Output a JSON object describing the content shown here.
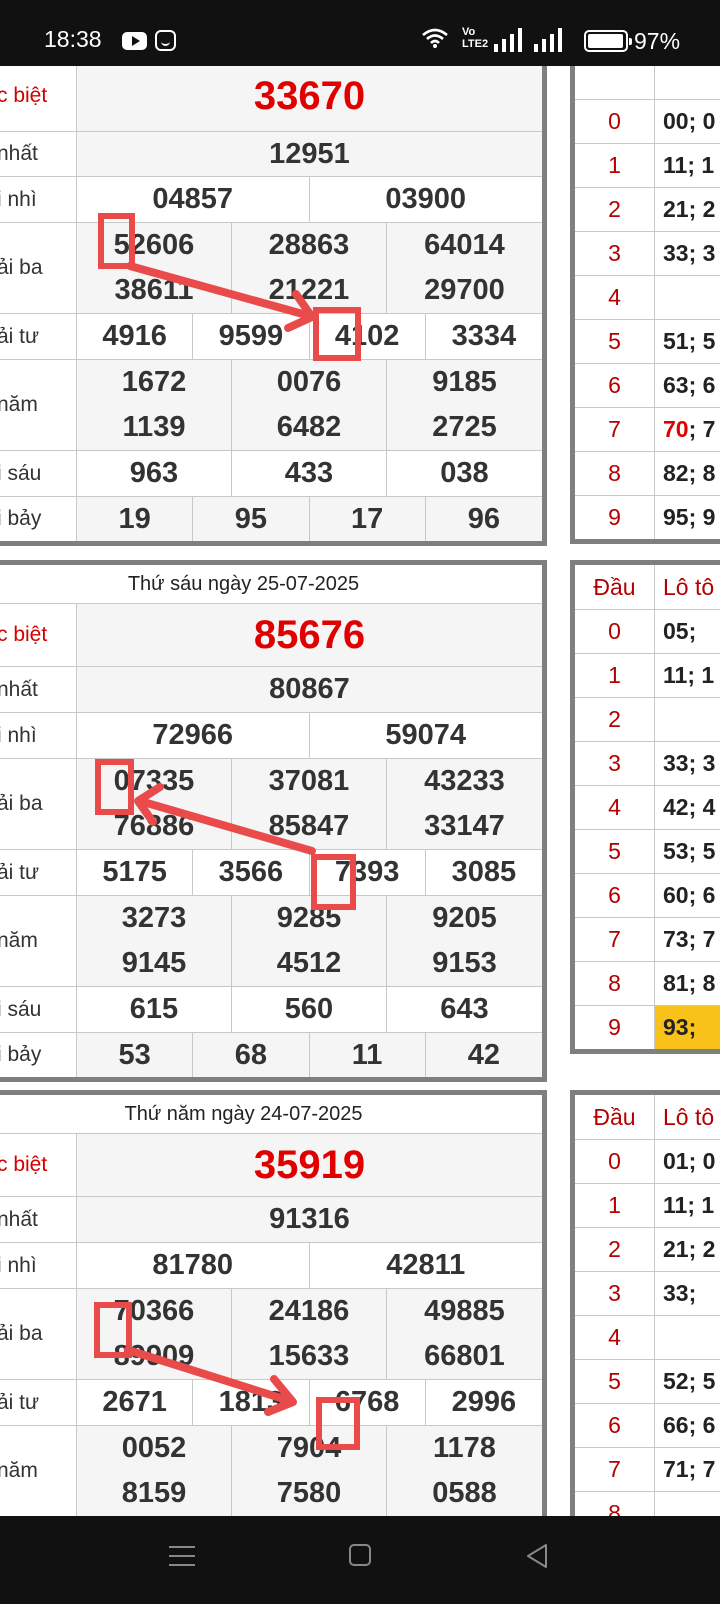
{
  "status_bar": {
    "time": "18:38",
    "battery": "97%",
    "volte_top": "Vo",
    "volte_bottom": "LTE2"
  },
  "labels": {
    "db": "c biệt",
    "g1": " nhất",
    "g2": "i nhì",
    "g3": "ải ba",
    "g4": "ải tư",
    "g5": " năm",
    "g6": "i sáu",
    "g7": "i bảy"
  },
  "side_header": {
    "dau": "Đầu",
    "loto": "Lô tô"
  },
  "results": [
    {
      "date": "",
      "db": [
        "33670"
      ],
      "g1": [
        "12951"
      ],
      "g2": [
        "04857",
        "03900"
      ],
      "g3": [
        "52606",
        "28863",
        "64014",
        "38611",
        "21221",
        "29700"
      ],
      "g4": [
        "4916",
        "9599",
        "4102",
        "3334"
      ],
      "g5": [
        "1672",
        "0076",
        "9185",
        "1139",
        "6482",
        "2725"
      ],
      "g6": [
        "963",
        "433",
        "038"
      ],
      "g7": [
        "19",
        "95",
        "17",
        "96"
      ]
    },
    {
      "date": "Thứ sáu ngày 25-07-2025",
      "db": [
        "85676"
      ],
      "g1": [
        "80867"
      ],
      "g2": [
        "72966",
        "59074"
      ],
      "g3": [
        "07335",
        "37081",
        "43233",
        "76886",
        "85847",
        "33147"
      ],
      "g4": [
        "5175",
        "3566",
        "7393",
        "3085"
      ],
      "g5": [
        "3273",
        "9285",
        "9205",
        "9145",
        "4512",
        "9153"
      ],
      "g6": [
        "615",
        "560",
        "643"
      ],
      "g7": [
        "53",
        "68",
        "11",
        "42"
      ]
    },
    {
      "date": "Thứ năm ngày 24-07-2025",
      "db": [
        "35919"
      ],
      "g1": [
        "91316"
      ],
      "g2": [
        "81780",
        "42811"
      ],
      "g3": [
        "70366",
        "24186",
        "49885",
        "89909",
        "15633",
        "66801"
      ],
      "g4": [
        "2671",
        "1813",
        "6768",
        "2996"
      ],
      "g5": [
        "0052",
        "7904",
        "1178",
        "8159",
        "7580",
        "0588"
      ]
    }
  ],
  "loto": [
    [
      {
        "d": "0",
        "l": "00; 0"
      },
      {
        "d": "1",
        "l": "11; 1"
      },
      {
        "d": "2",
        "l": "21; 2"
      },
      {
        "d": "3",
        "l": "33; 3"
      },
      {
        "d": "4",
        "l": ""
      },
      {
        "d": "5",
        "l": "51; 5"
      },
      {
        "d": "6",
        "l": "63; 6"
      },
      {
        "d": "7",
        "hl": "70",
        "l": "; 7"
      },
      {
        "d": "8",
        "l": "82; 8"
      },
      {
        "d": "9",
        "l": "95; 9"
      }
    ],
    [
      {
        "d": "0",
        "l": "05;"
      },
      {
        "d": "1",
        "l": "11; 1"
      },
      {
        "d": "2",
        "l": ""
      },
      {
        "d": "3",
        "l": "33; 3"
      },
      {
        "d": "4",
        "l": "42; 4"
      },
      {
        "d": "5",
        "l": "53; 5"
      },
      {
        "d": "6",
        "l": "60; 6"
      },
      {
        "d": "7",
        "l": "73; 7"
      },
      {
        "d": "8",
        "l": "81; 8"
      },
      {
        "d": "9",
        "l": "93;",
        "yellow": true
      }
    ],
    [
      {
        "d": "0",
        "l": "01; 0"
      },
      {
        "d": "1",
        "l": "11; 1"
      },
      {
        "d": "2",
        "l": "21; 2"
      },
      {
        "d": "3",
        "l": "33;"
      },
      {
        "d": "4",
        "l": ""
      },
      {
        "d": "5",
        "l": "52; 5"
      },
      {
        "d": "6",
        "l": "66; 6"
      },
      {
        "d": "7",
        "l": "71; 7"
      },
      {
        "d": "8",
        "l": ""
      }
    ]
  ]
}
